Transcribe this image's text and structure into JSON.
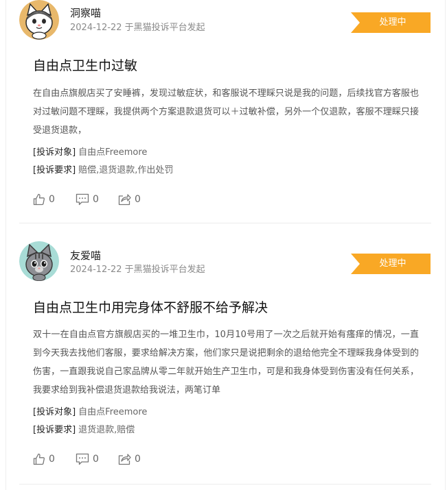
{
  "colors": {
    "status_bg": "#F9A825",
    "title": "#111111",
    "meta": "#8A8A8A"
  },
  "complaints": [
    {
      "user": "洞察喵",
      "meta": "2024-12-22 于黑猫投诉平台发起",
      "status": "处理中",
      "title": "自由点卫生巾过敏",
      "body": "在自由点旗舰店买了安睡裤，发现过敏症状，和客服说不理睬只说是我的问题，后续找官方客服也对过敏问题不理睬，我提供两个方案退款退货可以＋过敏补偿，另外一个仅退款，客服不理睬只接受退货退款，",
      "target_label": "[投诉对象]",
      "target": "自由点Freemore",
      "demand_label": "[投诉要求]",
      "demand": "赔偿,退货退款,作出处罚",
      "likes": "0",
      "comments": "0",
      "shares": "0"
    },
    {
      "user": "友爱喵",
      "meta": "2024-12-22 于黑猫投诉平台发起",
      "status": "处理中",
      "title": "自由点卫生巾用完身体不舒服不给予解决",
      "body": "双十一在自由点官方旗舰店买的一堆卫生巾，10月10号用了一次之后就开始有瘙痒的情况，一直到今天我去找他们客服，要求给解决方案，他们家只是说把剩余的退给他完全不理睬我身体受到的伤害，一直跟我说自己家品牌从零二年就开始生产卫生巾，可是和我身体受到伤害没有任何关系，我要求给到我补偿退货退款给我说法，两笔订单",
      "target_label": "[投诉对象]",
      "target": "自由点Freemore",
      "demand_label": "[投诉要求]",
      "demand": "退货退款,赔偿",
      "likes": "0",
      "comments": "0",
      "shares": "0"
    }
  ]
}
